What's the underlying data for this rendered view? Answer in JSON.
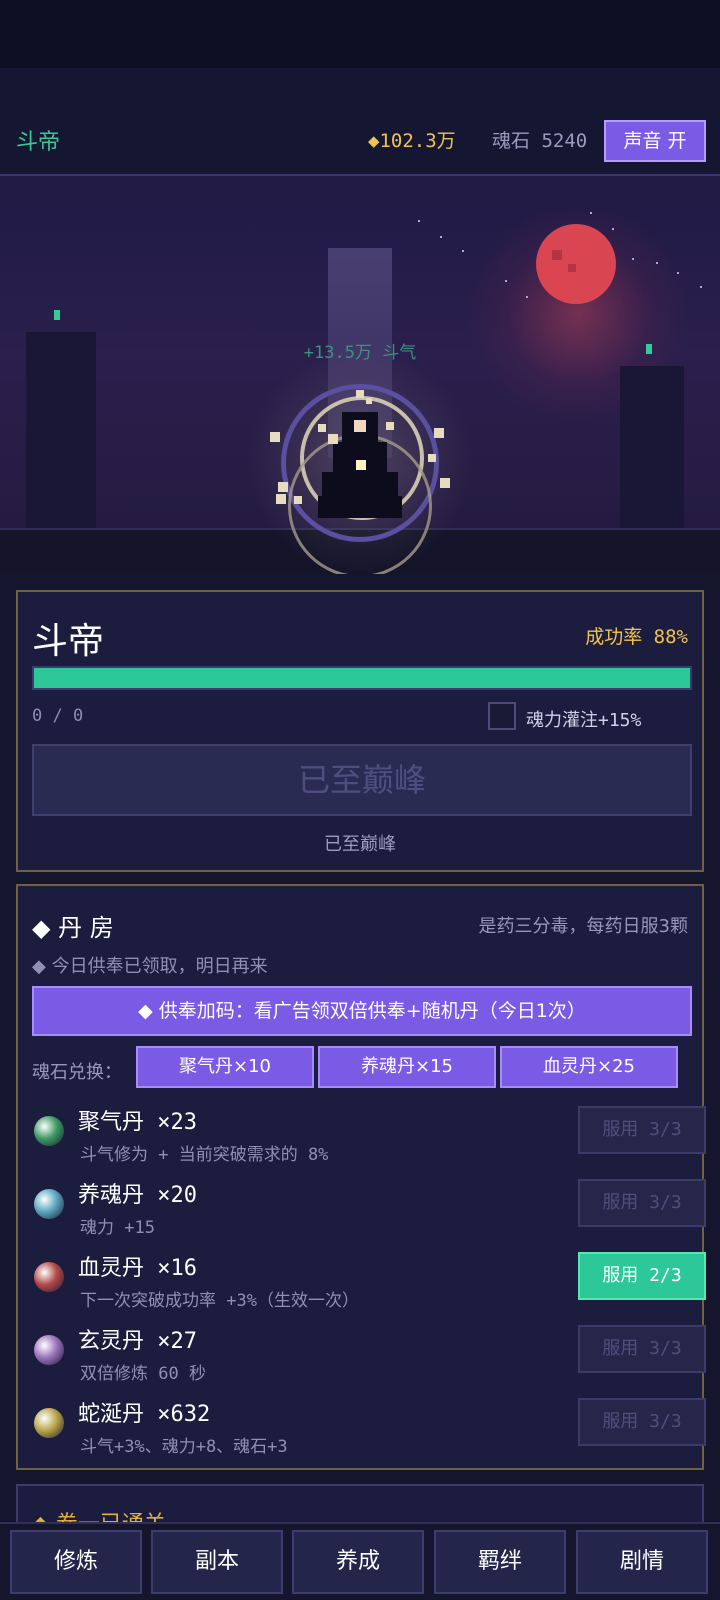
{
  "header": {
    "realm": "斗帝",
    "gold": "◆102.3万",
    "soulstone": "魂石 5240",
    "sound_button": "声音 开"
  },
  "scene": {
    "gain_text": "+13.5万 斗气"
  },
  "realm_panel": {
    "title": "斗帝",
    "success_rate": "成功率 88%",
    "progress": 1.0,
    "progress_text": "0 / 0",
    "infuse_label": "魂力灌注+15%",
    "breakthrough_button": "已至巅峰",
    "note": "已至巅峰"
  },
  "pill_room": {
    "title": "◆ 丹 房",
    "hint": "是药三分毒，每药日服3颗",
    "tribute_note": "◆ 今日供奉已领取，明日再来",
    "ad_button": "◆ 供奉加码：看广告领双倍供奉+随机丹（今日1次）",
    "exchange_label": "魂石兑换：",
    "exchange_buttons": [
      "聚气丹×10",
      "养魂丹×15",
      "血灵丹×25"
    ],
    "pills": [
      {
        "name": "聚气丹 ×23",
        "desc": "斗气修为 + 当前突破需求的 8%",
        "button": "服用 3/3",
        "color": "#3e9a64"
      },
      {
        "name": "养魂丹 ×20",
        "desc": "魂力 +15",
        "button": "服用 3/3",
        "color": "#5aa6be"
      },
      {
        "name": "血灵丹 ×16",
        "desc": "下一次突破成功率 +3%（生效一次）",
        "button": "服用 2/3",
        "color": "#b24a48"
      },
      {
        "name": "玄灵丹 ×27",
        "desc": "双倍修炼 60 秒",
        "button": "服用 3/3",
        "color": "#9a72bc"
      },
      {
        "name": "蛇涎丹 ×632",
        "desc": "斗气+3%、魂力+8、魂石+3",
        "button": "服用 3/3",
        "color": "#b8a548"
      }
    ]
  },
  "next_section": {
    "title": "◆ 卷一已通关"
  },
  "bottom_nav": [
    "修炼",
    "副本",
    "养成",
    "羁绊",
    "剧情"
  ]
}
